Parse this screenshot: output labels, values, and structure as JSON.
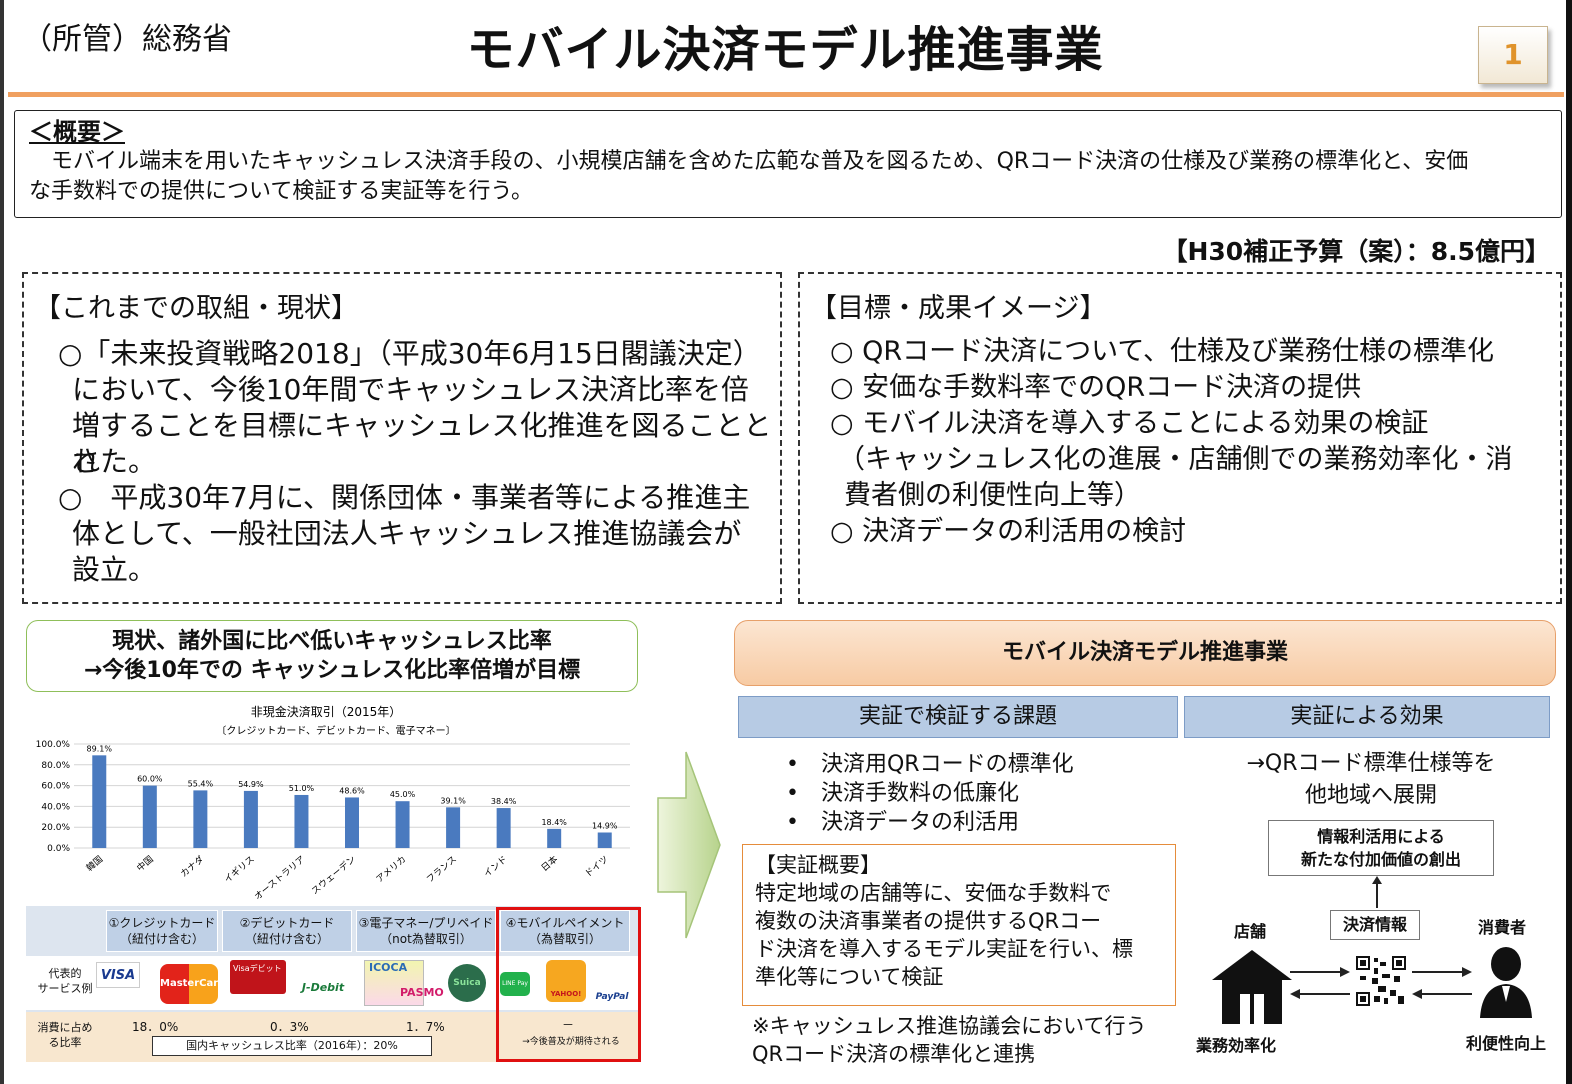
{
  "header": {
    "ministry": "（所管）総務省",
    "title": "モバイル決済モデル推進事業",
    "page_number": "1"
  },
  "overview": {
    "heading": "＜概要＞",
    "line1": "　モバイル端末を用いたキャッシュレス決済手段の、小規模店舗を含めた広範な普及を図るため、QRコード決済の仕様及び業務の標準化と、安価",
    "line2": "な手数料での提供について検証する実証等を行う。"
  },
  "budget": "【H30補正予算（案）：8.5億円】",
  "left_box": {
    "heading": "【これまでの取組・現状】",
    "lines": [
      "○「未来投資戦略2018」（平成30年6月15日閣議決定）",
      "において、今後10年間でキャッシュレス決済比率を倍",
      "増することを目標にキャッシュレス化推進を図ることとさ",
      "れた。",
      "○　平成30年7月に、関係団体・事業者等による推進主",
      "体として、一般社団法人キャッシュレス推進協議会が",
      "設立。"
    ]
  },
  "right_box": {
    "heading": "【目標・成果イメージ】",
    "lines": [
      "○ QRコード決済について、仕様及び業務仕様の標準化",
      "○ 安価な手数料率でのQRコード決済の提供",
      "○ モバイル決済を導入することによる効果の検証",
      "（キャッシュレス化の進展・店舗側での業務効率化・消",
      "費者側の利便性向上等）",
      "○ 決済データの利活用の検討"
    ]
  },
  "green_box": {
    "line1": "現状、諸外国に比べ低いキャッシュレス比率",
    "line2": "→今後10年での キャッシュレス化比率倍増が目標"
  },
  "chart_data": {
    "type": "bar",
    "title": "非現金決済取引（2015年）",
    "subtitle": "〔クレジットカード、デビットカード、電子マネー〕",
    "categories": [
      "韓国",
      "中国",
      "カナダ",
      "イギリス",
      "オーストラリア",
      "スウェーデン",
      "アメリカ",
      "フランス",
      "インド",
      "日本",
      "ドイツ"
    ],
    "values": [
      89.1,
      60.0,
      55.4,
      54.9,
      51.0,
      48.6,
      45.0,
      39.1,
      38.4,
      18.4,
      14.9
    ],
    "value_labels": [
      "89.1%",
      "60.0%",
      "55.4%",
      "54.9%",
      "51.0%",
      "48.6%",
      "45.0%",
      "39.1%",
      "38.4%",
      "18.4%",
      "14.9%"
    ],
    "yticks": [
      "100.0%",
      "80.0%",
      "60.0%",
      "40.0%",
      "20.0%",
      "0.0%"
    ],
    "ylim": [
      0,
      100
    ],
    "grid": true,
    "bar_color": "#4a7abf"
  },
  "payment_table": {
    "headers": [
      "①クレジットカード\n（紐付け含む）",
      "②デビットカード\n（紐付け含む）",
      "③電子マネー/プリペイド\n（not為替取引）",
      "④モバイルペイメント\n（為替取引）"
    ],
    "row1_label": "代表的\nサービス例",
    "row2_label": "消費に占め\nる比率",
    "ratios": [
      "18．0%",
      "0．3%",
      "1．7%",
      "－"
    ],
    "mobile_note": "→今後普及が期待される",
    "total_ratio": "国内キャッシュレス比率（2016年）：20%",
    "brand_visa": "VISA",
    "brand_master": "MasterCard",
    "brand_visa_debit": "Visaデビット",
    "brand_jdebit": "J-Debit",
    "brand_icoca": "ICOCA",
    "brand_pasmo": "PASMO",
    "brand_suica": "Suica",
    "brand_line": "LINE Pay",
    "brand_yahoo": "YAHOO!",
    "brand_paypal": "PayPal"
  },
  "model": {
    "title": "モバイル決済モデル推進事業",
    "issues_header": "実証で検証する課題",
    "effects_header": "実証による効果",
    "issues": [
      "決済用QRコードの標準化",
      "決済手数料の低廉化",
      "決済データの利活用"
    ],
    "effect_line1": "→QRコード標準仕様等を",
    "effect_line2": "他地域へ展開",
    "info_line1": "情報利活用による",
    "info_line2": "新たな付加価値の創出",
    "proof_heading": "【実証概要】",
    "proof_lines": [
      "特定地域の店舗等に、安価な手数料で",
      "複数の決済事業者の提供するQRコー",
      "ド決済を導入するモデル実証を行い、標",
      "準化等について検証"
    ],
    "note_line1": "※キャッシュレス推進協議会において行う",
    "note_line2": "QRコード決済の標準化と連携",
    "store_label": "店舗",
    "payinfo_label": "決済情報",
    "consumer_label": "消費者",
    "store_effect": "業務効率化",
    "consumer_effect": "利便性向上"
  }
}
